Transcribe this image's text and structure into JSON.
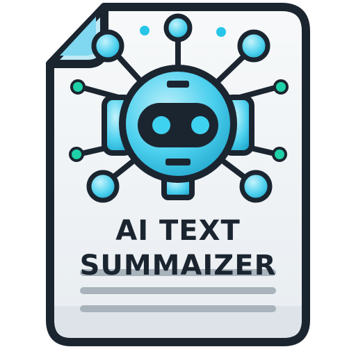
{
  "logo": {
    "title_line1": "AI TEXT",
    "title_line2": "SUMMAIZER",
    "icon": "robot-head-icon",
    "colors": {
      "outline": "#1b2530",
      "paper": "#f4f6f8",
      "paper_shadow": "#dde3e8",
      "accent_cyan": "#27c6e8",
      "accent_light": "#8fe3f5",
      "accent_teal": "#1fd1a8",
      "text_lines": "#a9b3bc"
    }
  }
}
